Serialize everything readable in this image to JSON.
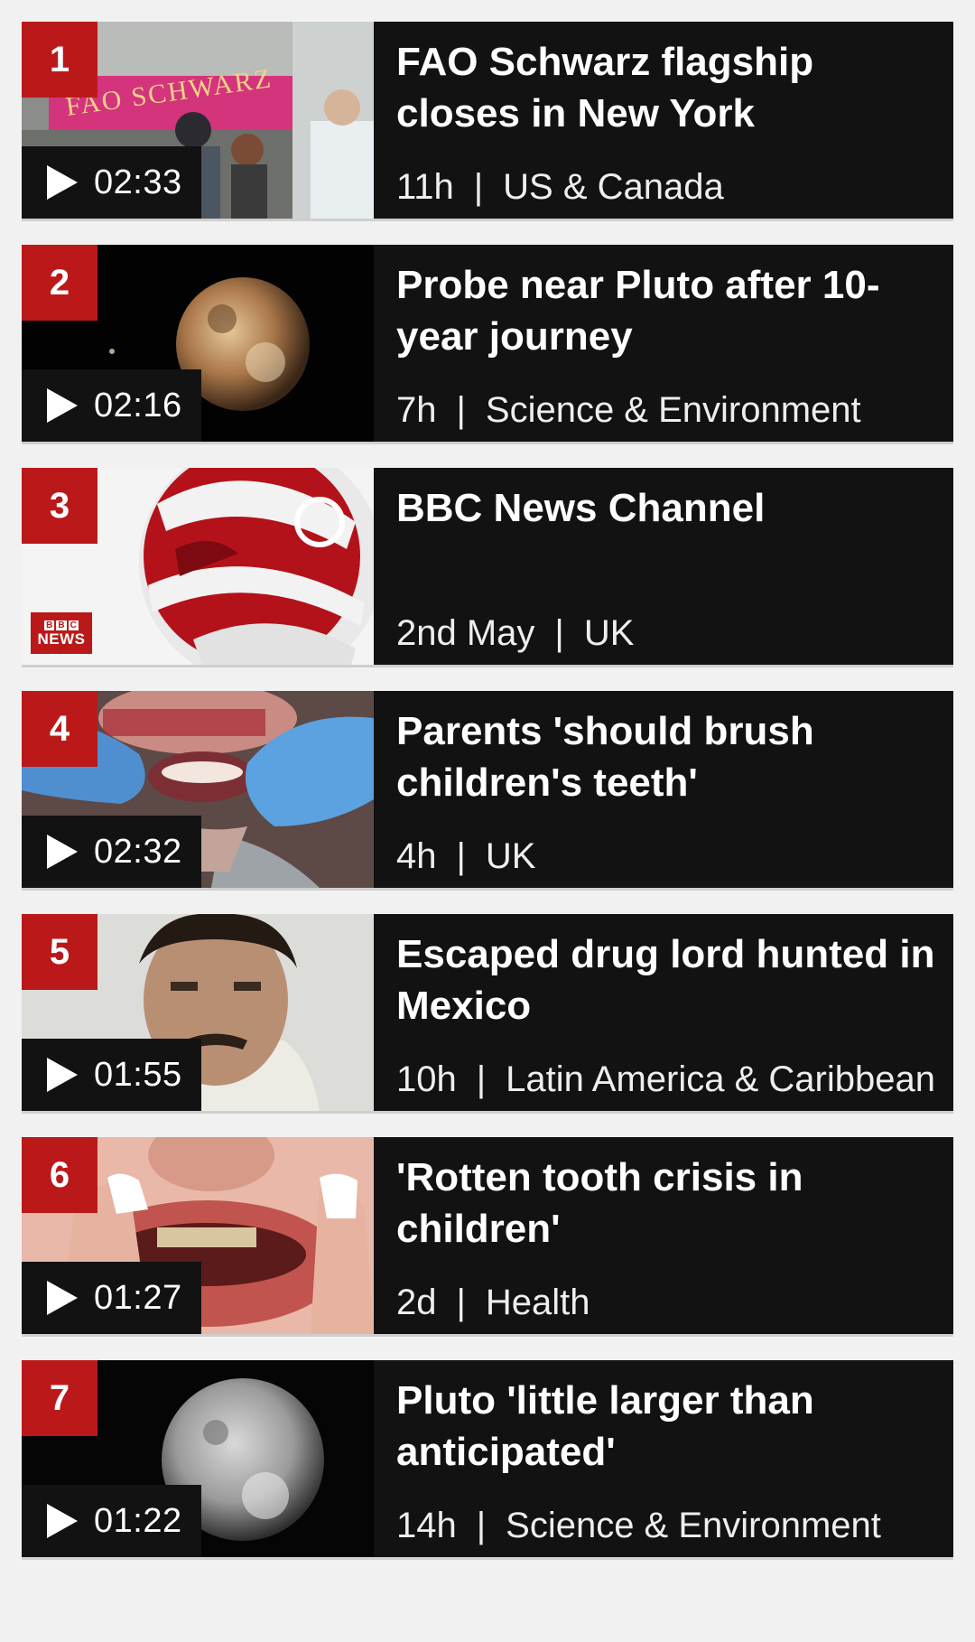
{
  "items": [
    {
      "rank": "1",
      "title": "FAO Schwarz flagship closes in New York",
      "duration": "02:33",
      "age": "11h",
      "section": "US & Canada",
      "thumb_sign": "FAO SCHWARZ"
    },
    {
      "rank": "2",
      "title": "Probe near Pluto after 10-year journey",
      "duration": "02:16",
      "age": "7h",
      "section": "Science & Environment"
    },
    {
      "rank": "3",
      "title": "BBC News Channel",
      "duration": null,
      "age": "2nd May",
      "section": "UK",
      "logo_top": [
        "B",
        "B",
        "C"
      ],
      "logo_bottom": "NEWS"
    },
    {
      "rank": "4",
      "title": "Parents 'should brush children's teeth'",
      "duration": "02:32",
      "age": "4h",
      "section": "UK"
    },
    {
      "rank": "5",
      "title": "Escaped drug lord hunted in Mexico",
      "duration": "01:55",
      "age": "10h",
      "section": "Latin America & Caribbean"
    },
    {
      "rank": "6",
      "title": "'Rotten tooth crisis in children'",
      "duration": "01:27",
      "age": "2d",
      "section": "Health"
    },
    {
      "rank": "7",
      "title": "Pluto 'little larger than anticipated'",
      "duration": "01:22",
      "age": "14h",
      "section": "Science & Environment"
    }
  ],
  "separator": "|",
  "colors": {
    "accent": "#bb1919",
    "card_bg": "#121212",
    "page_bg": "#f1f1f1"
  }
}
